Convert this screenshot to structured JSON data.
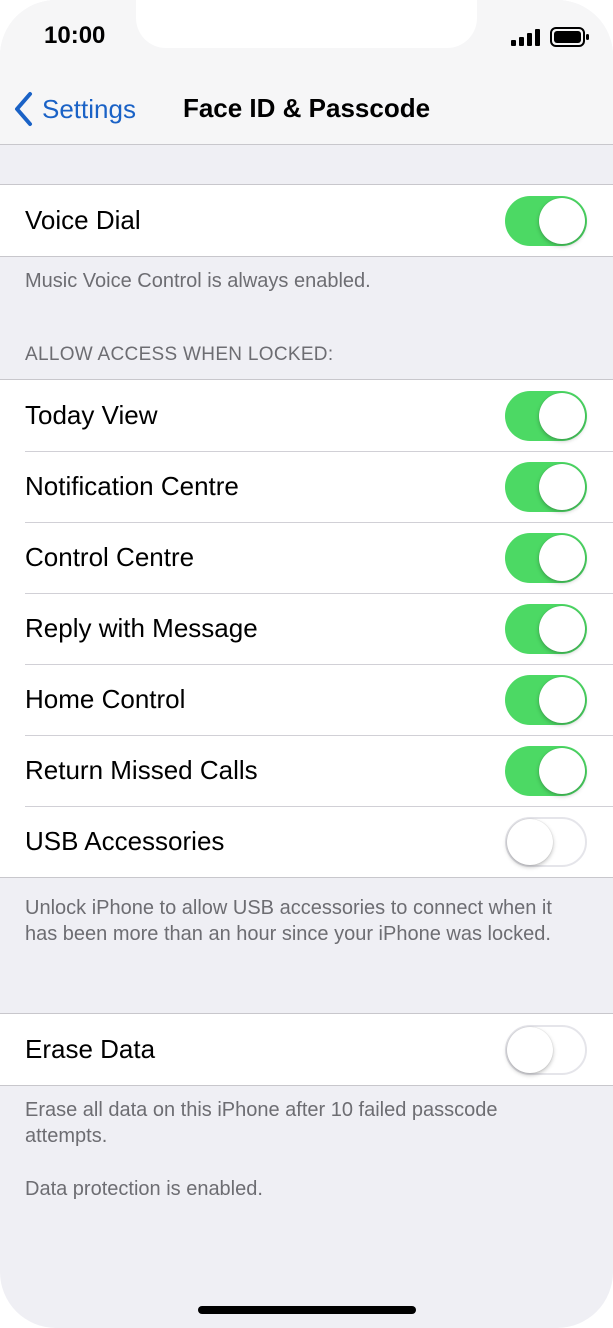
{
  "status_bar": {
    "time": "10:00"
  },
  "nav": {
    "back_label": "Settings",
    "title": "Face ID & Passcode"
  },
  "voice_dial": {
    "label": "Voice Dial",
    "on": true
  },
  "voice_footer": "Music Voice Control is always enabled.",
  "locked_header": "ALLOW ACCESS WHEN LOCKED:",
  "locked_items": [
    {
      "label": "Today View",
      "on": true
    },
    {
      "label": "Notification Centre",
      "on": true
    },
    {
      "label": "Control Centre",
      "on": true
    },
    {
      "label": "Reply with Message",
      "on": true
    },
    {
      "label": "Home Control",
      "on": true
    },
    {
      "label": "Return Missed Calls",
      "on": true
    },
    {
      "label": "USB Accessories",
      "on": false
    }
  ],
  "usb_footer": "Unlock iPhone to allow USB accessories to connect when it has been more than an hour since your iPhone was locked.",
  "erase_data": {
    "label": "Erase Data",
    "on": false
  },
  "erase_footer": "Erase all data on this iPhone after 10 failed passcode attempts.",
  "protection_footer": "Data protection is enabled.",
  "colors": {
    "accent": "#1a62c6",
    "toggle_on": "#4cd964",
    "background": "#efeff4"
  }
}
